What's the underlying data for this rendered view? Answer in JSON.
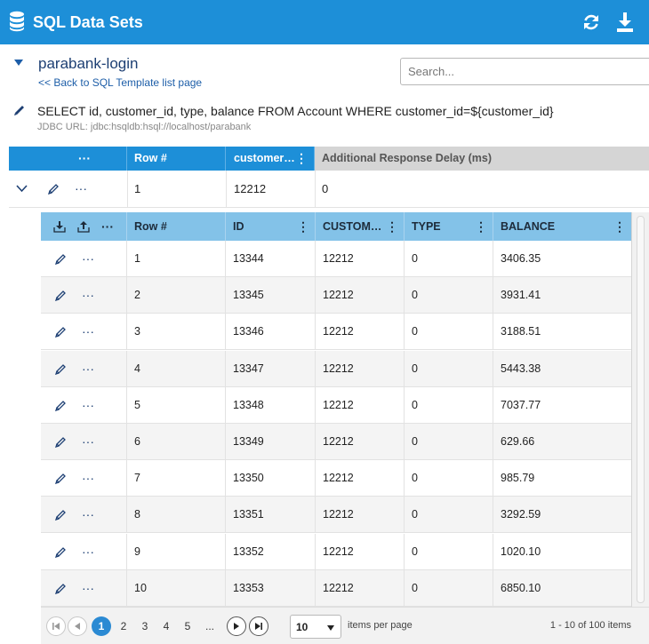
{
  "topbar": {
    "title": "SQL Data Sets",
    "icons": [
      "database-icon",
      "refresh-icon",
      "download-icon"
    ]
  },
  "dataset": {
    "name": "parabank-login",
    "back_link": "<< Back to SQL Template list page",
    "sql": "SELECT id, customer_id, type, balance FROM Account WHERE customer_id=${customer_id}",
    "jdbc": "JDBC URL: jdbc:hsqldb:hsql://localhost/parabank"
  },
  "search": {
    "placeholder": "Search..."
  },
  "outer_grid": {
    "actions_header": "···",
    "columns": [
      "Row #",
      "customer…",
      "Additional Response Delay (ms)"
    ],
    "row": {
      "row_num": "1",
      "customer_id": "12212",
      "delay": "0",
      "dots": "···"
    }
  },
  "inner_grid": {
    "actions_header": "···",
    "columns": [
      "Row #",
      "ID",
      "CUSTOM…",
      "TYPE",
      "BALANCE"
    ],
    "rows": [
      {
        "row": "1",
        "id": "13344",
        "customer": "12212",
        "type": "0",
        "balance": "3406.35"
      },
      {
        "row": "2",
        "id": "13345",
        "customer": "12212",
        "type": "0",
        "balance": "3931.41"
      },
      {
        "row": "3",
        "id": "13346",
        "customer": "12212",
        "type": "0",
        "balance": "3188.51"
      },
      {
        "row": "4",
        "id": "13347",
        "customer": "12212",
        "type": "0",
        "balance": "5443.38"
      },
      {
        "row": "5",
        "id": "13348",
        "customer": "12212",
        "type": "0",
        "balance": "7037.77"
      },
      {
        "row": "6",
        "id": "13349",
        "customer": "12212",
        "type": "0",
        "balance": "629.66"
      },
      {
        "row": "7",
        "id": "13350",
        "customer": "12212",
        "type": "0",
        "balance": "985.79"
      },
      {
        "row": "8",
        "id": "13351",
        "customer": "12212",
        "type": "0",
        "balance": "3292.59"
      },
      {
        "row": "9",
        "id": "13352",
        "customer": "12212",
        "type": "0",
        "balance": "1020.10"
      },
      {
        "row": "10",
        "id": "13353",
        "customer": "12212",
        "type": "0",
        "balance": "6850.10"
      }
    ],
    "row_dots": "···"
  },
  "pager": {
    "pages": [
      "1",
      "2",
      "3",
      "4",
      "5",
      "..."
    ],
    "current_page": "1",
    "page_size": "10",
    "per_page_label": "items per page",
    "count_label": "1 - 10 of 100 items"
  },
  "colors": {
    "accent": "#1d8fd8",
    "inner_header": "#83c2e8",
    "active_page": "#2b8ad3"
  }
}
